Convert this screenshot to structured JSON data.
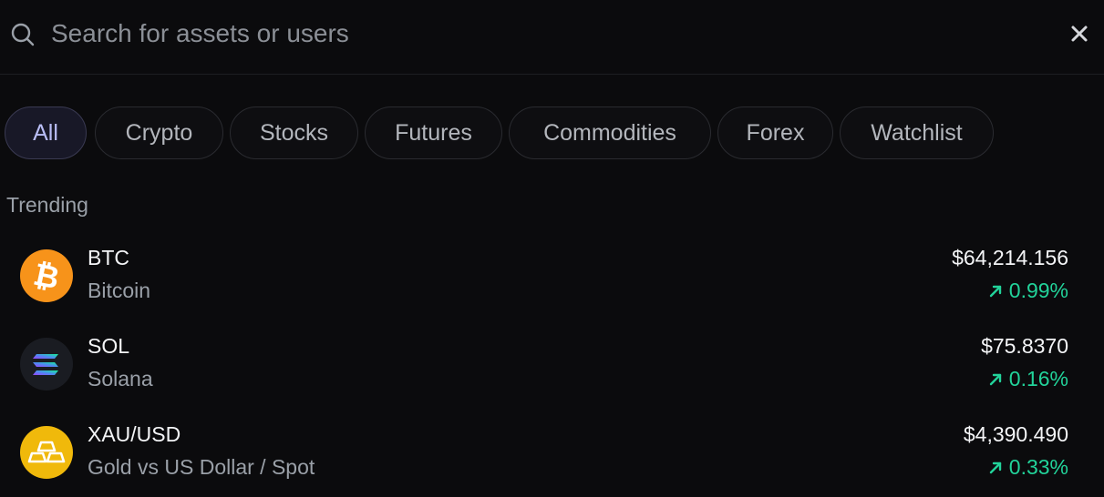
{
  "search": {
    "placeholder": "Search for assets or users",
    "value": ""
  },
  "filters": {
    "selected": "All",
    "chips": [
      "All",
      "Crypto",
      "Stocks",
      "Futures",
      "Commodities",
      "Forex",
      "Watchlist"
    ]
  },
  "trending": {
    "title": "Trending",
    "assets": [
      {
        "symbol": "BTC",
        "name": "Bitcoin",
        "price": "$64,214.156",
        "change": "0.99%",
        "direction": "up",
        "icon": "bitcoin-icon"
      },
      {
        "symbol": "SOL",
        "name": "Solana",
        "price": "$75.8370",
        "change": "0.16%",
        "direction": "up",
        "icon": "solana-icon"
      },
      {
        "symbol": "XAU/USD",
        "name": "Gold vs US Dollar / Spot",
        "price": "$4,390.490",
        "change": "0.33%",
        "direction": "up",
        "icon": "gold-bars-icon"
      }
    ]
  },
  "colors": {
    "background": "#0b0b0d",
    "positive": "#22d39a",
    "bitcoin": "#f7931a",
    "gold": "#f0b90b",
    "active_chip": "#b9bdf5"
  }
}
